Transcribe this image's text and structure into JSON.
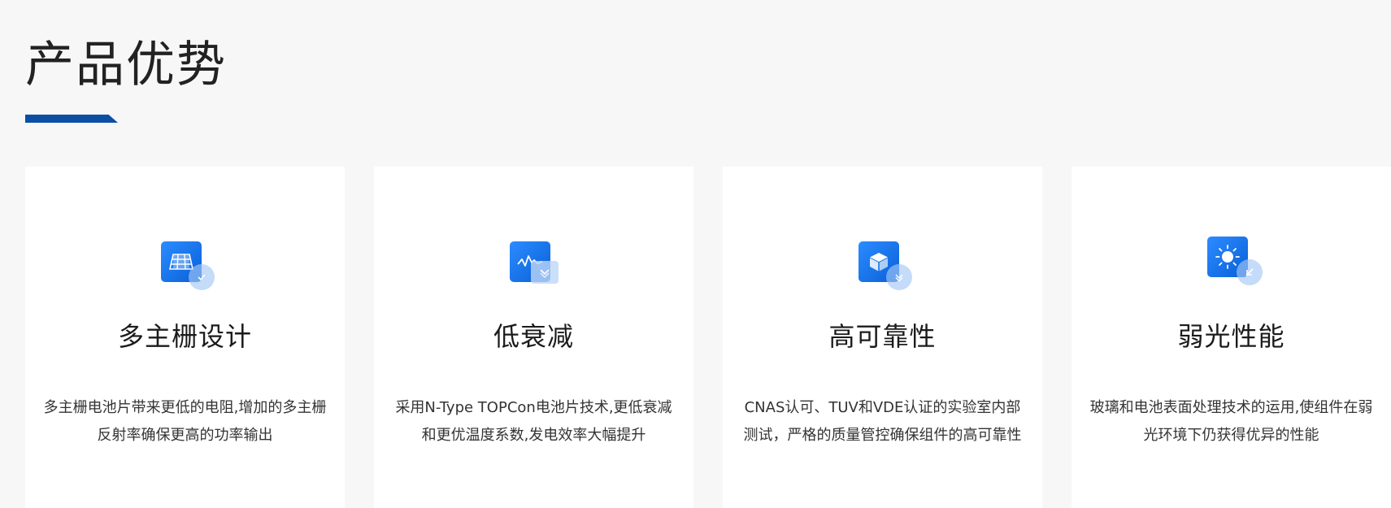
{
  "section": {
    "title": "产品优势"
  },
  "colors": {
    "accent": "#0a4fa3",
    "icon_blue": "#0a5fd7",
    "card_bg": "#ffffff",
    "page_bg": "#f7f7f7"
  },
  "cards": [
    {
      "icon": "solar-panel-icon",
      "title": "多主栅设计",
      "description": "多主栅电池片带来更低的电阻,增加的多主栅反射率确保更高的功率输出"
    },
    {
      "icon": "chart-wave-icon",
      "title": "低衰减",
      "description": "采用N-Type TOPCon电池片技术,更低衰减和更优温度系数,发电效率大幅提升"
    },
    {
      "icon": "cube-shield-icon",
      "title": "高可靠性",
      "description": "CNAS认可、TUV和VDE认证的实验室内部测试，严格的质量管控确保组件的高可靠性"
    },
    {
      "icon": "sun-icon",
      "title": "弱光性能",
      "description": "玻璃和电池表面处理技术的运用,使组件在弱光环境下仍获得优异的性能"
    }
  ]
}
